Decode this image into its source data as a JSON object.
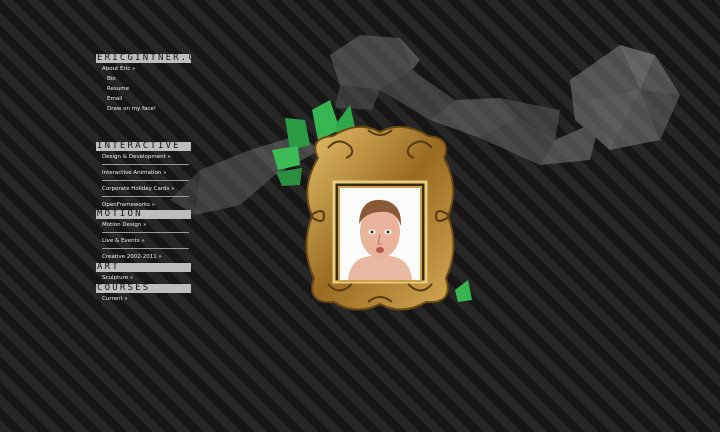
{
  "site": {
    "logo": "ERICGINTNER.COM",
    "about": "About Eric »",
    "about_links": [
      "Bio",
      "Resume",
      "Email",
      "Draw on my face!"
    ]
  },
  "sections": {
    "interactive": {
      "title": "INTERACTIVE",
      "items": [
        "Design & Development »",
        "Interactive Animation »",
        "Corporate Holiday Cards »",
        "OpenFrameworks »"
      ]
    },
    "motion": {
      "title": "MOTION",
      "items": [
        "Motion Design »",
        "Live & Events »",
        "Creative 2002-2011 »"
      ]
    },
    "art": {
      "title": "ART",
      "items": [
        "Sculpture »"
      ]
    },
    "courses": {
      "title": "COURSES",
      "items": [
        "Current »"
      ]
    }
  },
  "colors": {
    "background": "#1b1b1b",
    "stripe": "#262626",
    "header_bar": "#bdbdbd",
    "frame_gold": "#b8892f",
    "leaf_green": "#2fa84a"
  }
}
